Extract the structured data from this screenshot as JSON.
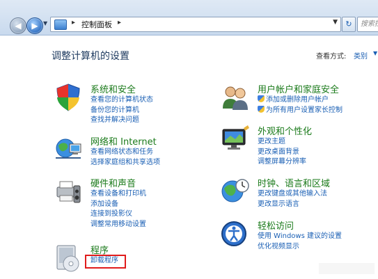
{
  "address_bar": {
    "breadcrumb": "控制面板",
    "search_placeholder": "搜索控件"
  },
  "header": {
    "title": "调整计算机的设置",
    "view_label": "查看方式:",
    "view_value": "类别"
  },
  "categories": [
    {
      "title": "系统和安全",
      "icon": "shield-icon",
      "links": [
        "查看您的计算机状态",
        "备份您的计算机",
        "查找并解决问题"
      ]
    },
    {
      "title": "网络和 Internet",
      "icon": "network-icon",
      "links": [
        "查看网络状态和任务",
        "选择家庭组和共享选项"
      ]
    },
    {
      "title": "硬件和声音",
      "icon": "printer-icon",
      "links": [
        "查看设备和打印机",
        "添加设备",
        "连接到投影仪",
        "调整常用移动设置"
      ]
    },
    {
      "title": "程序",
      "icon": "programs-icon",
      "links": [
        "卸载程序"
      ]
    },
    {
      "title": "用户帐户和家庭安全",
      "icon": "users-icon",
      "links": [
        "添加或删除用户帐户",
        "为所有用户设置家长控制"
      ]
    },
    {
      "title": "外观和个性化",
      "icon": "monitor-icon",
      "links": [
        "更改主题",
        "更改桌面背景",
        "调整屏幕分辨率"
      ]
    },
    {
      "title": "时钟、语言和区域",
      "icon": "globe-clock-icon",
      "links": [
        "更改键盘或其他输入法",
        "更改显示语言"
      ]
    },
    {
      "title": "轻松访问",
      "icon": "accessibility-icon",
      "links": [
        "使用 Windows 建议的设置",
        "优化视频显示"
      ]
    }
  ],
  "colors": {
    "category_title": "#1a7a1a",
    "link": "#1a5fb4",
    "highlight_box": "#e01b1b"
  }
}
